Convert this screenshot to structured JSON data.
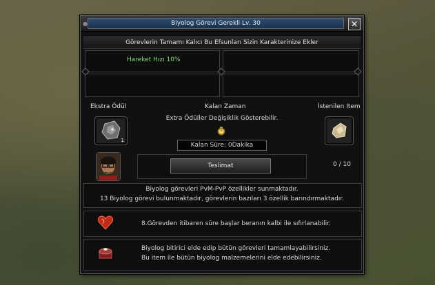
{
  "window": {
    "title": "Biyolog Görevi Gerekli Lv. 30",
    "close_label": "✕"
  },
  "bonus_section": {
    "header": "Görevlerin Tamamı Kalıcı Bu Efsunları Sizin Karakterinize Ekler",
    "bonus_1": "Hareket Hızı 10%"
  },
  "reward_section": {
    "extra_reward_label": "Ekstra Ödül",
    "remaining_time_label": "Kalan Zaman",
    "required_item_label": "İstenilen Item",
    "extra_note": "Extra Ödüller Değişiklik Gösterebilir.",
    "time_left": "Kalan Süre: 0Dakika",
    "submit_label": "Teslimat",
    "item_count": "0 / 10",
    "extra_item_quantity": "1"
  },
  "info_section": {
    "line_1": "Biyolog görevleri PvM-PvP özellikler sunmaktadır.",
    "line_2": "13 Biyolog görevi bulunmaktadır, görevlerin bazıları 3 özellik barındırmaktadır.",
    "line_3": "8.Görevden itibaren süre başlar beranın kalbi ile sıfırlanabilir.",
    "line_4": "Biyolog bitirici elde edip bütün görevleri tamamlayabilirsiniz.",
    "line_5": "Bu item ile bütün biyolog malzemelerini elde edebilirsiniz."
  },
  "colors": {
    "title_bar": "#24405f",
    "bonus_text": "#7ce07c",
    "panel_bg": "#111111"
  }
}
